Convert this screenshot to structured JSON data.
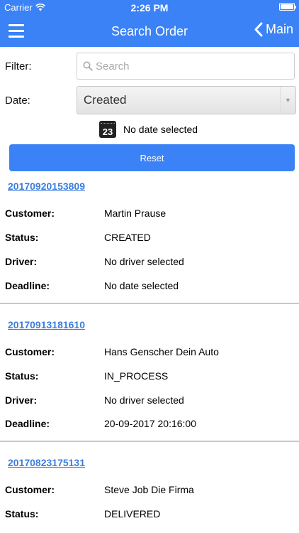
{
  "status_bar": {
    "carrier": "Carrier",
    "time": "2:26 PM",
    "battery_level": 1.0
  },
  "nav": {
    "title": "Search Order",
    "back_label": "Main"
  },
  "filter": {
    "label": "Filter:",
    "search_placeholder": "Search",
    "search_value": ""
  },
  "date": {
    "label": "Date:",
    "selected": "Created",
    "calendar_day": "23",
    "date_text": "No date selected"
  },
  "reset_label": "Reset",
  "field_labels": {
    "customer": "Customer:",
    "status": "Status:",
    "driver": "Driver:",
    "deadline": "Deadline:"
  },
  "orders": [
    {
      "id": "20170920153809",
      "customer": "Martin Prause",
      "status": "CREATED",
      "driver": "No driver selected",
      "deadline": "No date selected"
    },
    {
      "id": "20170913181610",
      "customer": "Hans Genscher Dein Auto",
      "status": "IN_PROCESS",
      "driver": "No driver selected",
      "deadline": "20-09-2017 20:16:00"
    },
    {
      "id": "20170823175131",
      "customer": "Steve Job Die Firma",
      "status": "DELIVERED"
    }
  ]
}
